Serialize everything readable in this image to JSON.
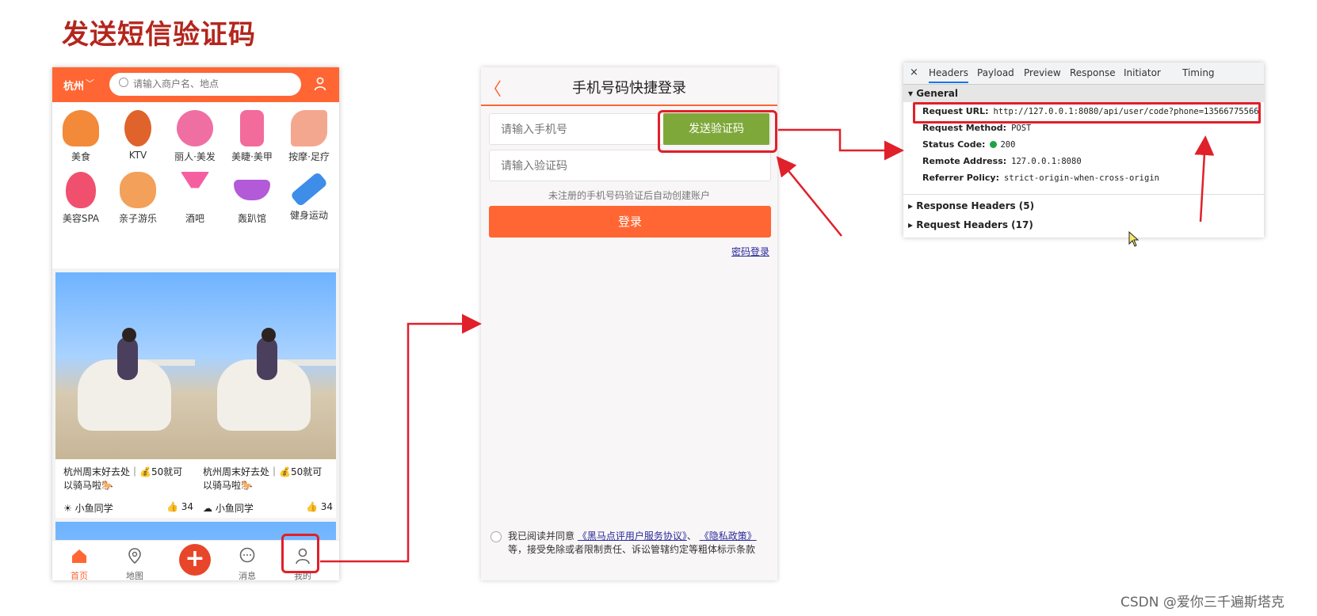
{
  "slide_title": "发送短信验证码",
  "phone_home": {
    "city": "杭州",
    "search_placeholder": "请输入商户名、地点",
    "categories": [
      {
        "label": "美食",
        "icon": "roast-chicken-icon",
        "color": "#f28a3a"
      },
      {
        "label": "KTV",
        "icon": "microphone-icon",
        "color": "#e0632b"
      },
      {
        "label": "丽人·美发",
        "icon": "hair-icon",
        "color": "#f06fa2"
      },
      {
        "label": "美睫·美甲",
        "icon": "nail-polish-icon",
        "color": "#f36b9a"
      },
      {
        "label": "按摩·足疗",
        "icon": "foot-icon",
        "color": "#f4a78f"
      },
      {
        "label": "美容SPA",
        "icon": "face-mask-icon",
        "color": "#f0506e"
      },
      {
        "label": "亲子游乐",
        "icon": "parent-child-icon",
        "color": "#f3a05a"
      },
      {
        "label": "酒吧",
        "icon": "cocktail-icon",
        "color": "#f55fa0"
      },
      {
        "label": "轰趴馆",
        "icon": "party-mask-icon",
        "color": "#b35ad8"
      },
      {
        "label": "健身运动",
        "icon": "dumbbell-icon",
        "color": "#3e8de8"
      }
    ],
    "cards": [
      {
        "title": "杭州周末好去处｜💰50就可以骑马啦🐎",
        "author": "小鱼同学",
        "likes": "34"
      },
      {
        "title": "杭州周末好去处｜💰50就可以骑马啦🐎",
        "author": "小鱼同学",
        "likes": "34"
      }
    ],
    "tabs": [
      {
        "label": "首页",
        "icon": "home-icon"
      },
      {
        "label": "地图",
        "icon": "map-pin-icon"
      },
      {
        "label": "消息",
        "icon": "message-icon"
      },
      {
        "label": "我的",
        "icon": "user-icon"
      }
    ],
    "accent": "#ff6633"
  },
  "phone_login": {
    "title": "手机号码快捷登录",
    "phone_placeholder": "请输入手机号",
    "send_code_label": "发送验证码",
    "code_placeholder": "请输入验证码",
    "hint": "未注册的手机号码验证后自动创建账户",
    "login_label": "登录",
    "password_login": "密码登录",
    "agree_prefix": "我已阅读并同意",
    "agree_link1": "《黑马点评用户服务协议》",
    "agree_sep": "、",
    "agree_link2": "《隐私政策》",
    "agree_suffix": "等，接受免除或者限制责任、诉讼管辖约定等粗体标示条款",
    "send_color": "#7fa83a"
  },
  "devtools": {
    "close": "×",
    "tabs": [
      "Headers",
      "Payload",
      "Preview",
      "Response",
      "Initiator",
      "Timing"
    ],
    "general_label": "General",
    "rows": [
      {
        "key": "Request URL:",
        "value": "http://127.0.0.1:8080/api/user/code?phone=13566775566"
      },
      {
        "key": "Request Method:",
        "value": "POST"
      },
      {
        "key": "Status Code:",
        "value": "200"
      },
      {
        "key": "Remote Address:",
        "value": "127.0.0.1:8080"
      },
      {
        "key": "Referrer Policy:",
        "value": "strict-origin-when-cross-origin"
      }
    ],
    "response_headers": "Response Headers (5)",
    "request_headers": "Request Headers (17)"
  },
  "watermark": "CSDN @爱你三千遍斯塔克",
  "highlight_color": "#e0202a"
}
